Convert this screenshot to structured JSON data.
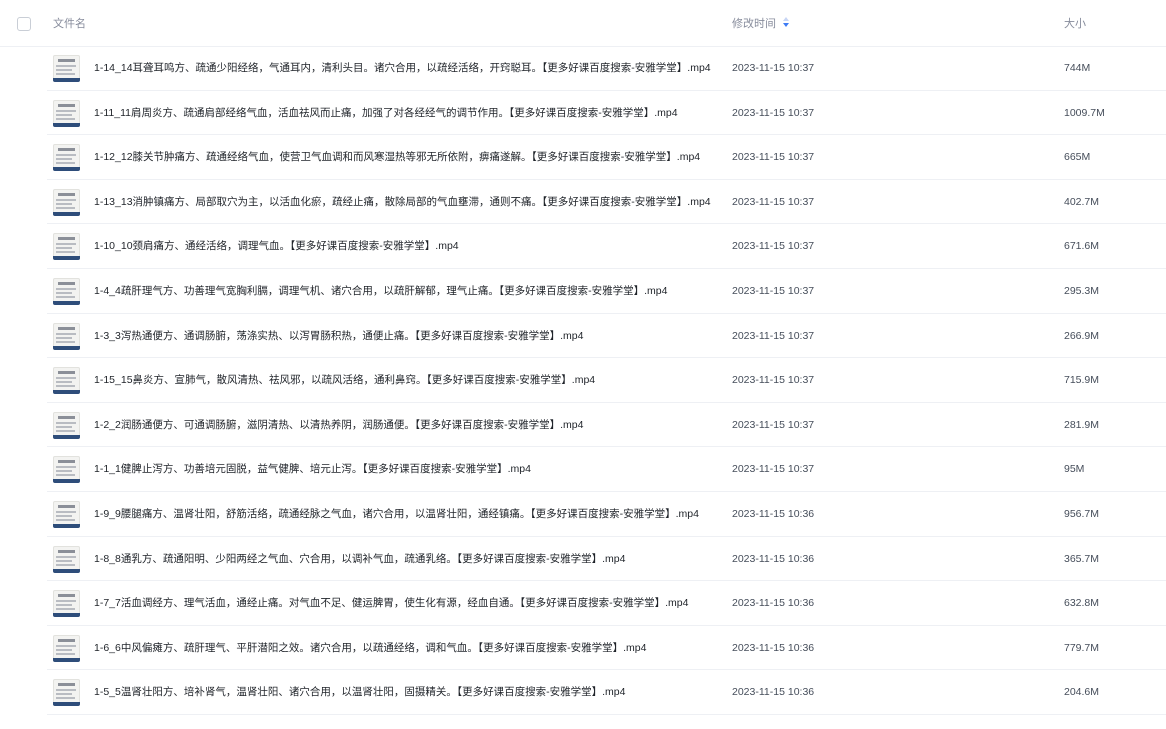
{
  "header": {
    "name_label": "文件名",
    "time_label": "修改时间",
    "size_label": "大小",
    "sort_icon": "sort-descending-icon",
    "sort_active_color": "#3d7bf5"
  },
  "files": [
    {
      "name": "1-14_14耳聋耳鸣方、疏通少阳经络，气通耳内，清利头目。诸穴合用，以疏经活络，开窍聪耳。【更多好课百度搜索-安雅学堂】.mp4",
      "time": "2023-11-15 10:37",
      "size": "744M",
      "icon": "video-thumbnail-icon"
    },
    {
      "name": "1-11_11肩周炎方、疏通肩部经络气血，活血祛风而止痛，加强了对各经经气的调节作用。【更多好课百度搜索-安雅学堂】.mp4",
      "time": "2023-11-15 10:37",
      "size": "1009.7M",
      "icon": "video-thumbnail-icon"
    },
    {
      "name": "1-12_12膝关节肿痛方、疏通经络气血，使营卫气血调和而风寒湿热等邪无所依附，痹痛遂解。【更多好课百度搜索-安雅学堂】.mp4",
      "time": "2023-11-15 10:37",
      "size": "665M",
      "icon": "video-thumbnail-icon"
    },
    {
      "name": "1-13_13消肿镇痛方、局部取穴为主，以活血化瘀，疏经止痛，散除局部的气血壅滞，通则不痛。【更多好课百度搜索-安雅学堂】.mp4",
      "time": "2023-11-15 10:37",
      "size": "402.7M",
      "icon": "video-thumbnail-icon"
    },
    {
      "name": "1-10_10颈肩痛方、通经活络，调理气血。【更多好课百度搜索-安雅学堂】.mp4",
      "time": "2023-11-15 10:37",
      "size": "671.6M",
      "icon": "video-thumbnail-icon"
    },
    {
      "name": "1-4_4疏肝理气方、功善理气宽胸利膈，调理气机、诸穴合用，以疏肝解郁，理气止痛。【更多好课百度搜索-安雅学堂】.mp4",
      "time": "2023-11-15 10:37",
      "size": "295.3M",
      "icon": "video-thumbnail-icon"
    },
    {
      "name": "1-3_3泻热通便方、通调肠腑，荡涤实热、以泻胃肠积热，通便止痛。【更多好课百度搜索-安雅学堂】.mp4",
      "time": "2023-11-15 10:37",
      "size": "266.9M",
      "icon": "video-thumbnail-icon"
    },
    {
      "name": "1-15_15鼻炎方、宣肺气，散风清热、祛风邪，以疏风活络，通利鼻窍。【更多好课百度搜索-安雅学堂】.mp4",
      "time": "2023-11-15 10:37",
      "size": "715.9M",
      "icon": "video-thumbnail-icon"
    },
    {
      "name": "1-2_2润肠通便方、可通调肠腑，滋阴清热、以清热养阴，润肠通便。【更多好课百度搜索-安雅学堂】.mp4",
      "time": "2023-11-15 10:37",
      "size": "281.9M",
      "icon": "video-thumbnail-icon"
    },
    {
      "name": "1-1_1健脾止泻方、功善培元固脱，益气健脾、培元止泻。【更多好课百度搜索-安雅学堂】.mp4",
      "time": "2023-11-15 10:37",
      "size": "95M",
      "icon": "video-thumbnail-icon"
    },
    {
      "name": "1-9_9腰腿痛方、温肾壮阳，舒筋活络，疏通经脉之气血，诸穴合用，以温肾壮阳，通经镇痛。【更多好课百度搜索-安雅学堂】.mp4",
      "time": "2023-11-15 10:36",
      "size": "956.7M",
      "icon": "video-thumbnail-icon"
    },
    {
      "name": "1-8_8通乳方、疏通阳明、少阳两经之气血、穴合用，以调补气血，疏通乳络。【更多好课百度搜索-安雅学堂】.mp4",
      "time": "2023-11-15 10:36",
      "size": "365.7M",
      "icon": "video-thumbnail-icon"
    },
    {
      "name": "1-7_7活血调经方、理气活血，通经止痛。对气血不足、健运脾胃，使生化有源，经血自通。【更多好课百度搜索-安雅学堂】.mp4",
      "time": "2023-11-15 10:36",
      "size": "632.8M",
      "icon": "video-thumbnail-icon"
    },
    {
      "name": "1-6_6中风偏瘫方、疏肝理气、平肝潜阳之效。诸穴合用，以疏通经络，调和气血。【更多好课百度搜索-安雅学堂】.mp4",
      "time": "2023-11-15 10:36",
      "size": "779.7M",
      "icon": "video-thumbnail-icon"
    },
    {
      "name": "1-5_5温肾壮阳方、培补肾气，温肾壮阳、诸穴合用，以温肾壮阳，固摄精关。【更多好课百度搜索-安雅学堂】.mp4",
      "time": "2023-11-15 10:36",
      "size": "204.6M",
      "icon": "video-thumbnail-icon"
    }
  ]
}
